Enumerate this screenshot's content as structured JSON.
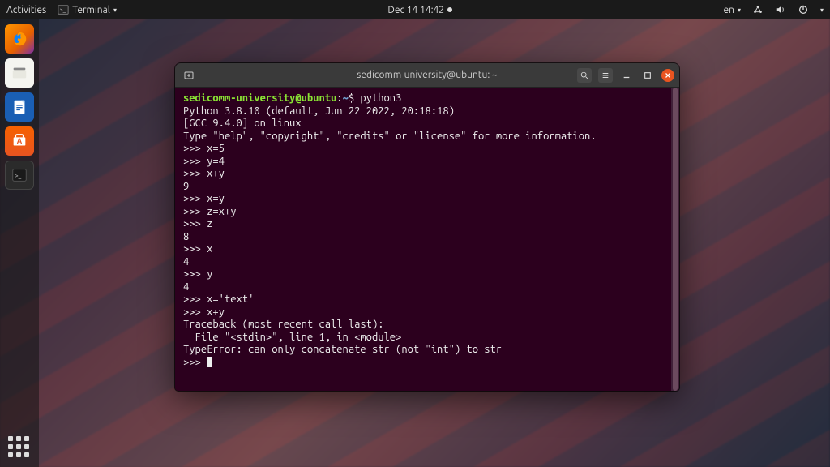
{
  "topbar": {
    "activities": "Activities",
    "app_label": "Terminal",
    "clock": "Dec 14  14:42",
    "lang": "en"
  },
  "dock": {
    "items": [
      "firefox",
      "files",
      "libreoffice-writer",
      "ubuntu-software",
      "terminal"
    ]
  },
  "terminal": {
    "title": "sedicomm-university@ubuntu: ~",
    "prompt_user": "sedicomm-university@ubuntu",
    "prompt_sep": ":",
    "prompt_path": "~",
    "prompt_dollar": "$ ",
    "command": "python3",
    "lines": [
      "Python 3.8.10 (default, Jun 22 2022, 20:18:18) ",
      "[GCC 9.4.0] on linux",
      "Type \"help\", \"copyright\", \"credits\" or \"license\" for more information.",
      ">>> x=5",
      ">>> y=4",
      ">>> x+y",
      "9",
      ">>> x=y",
      ">>> z=x+y",
      ">>> z",
      "8",
      ">>> x",
      "4",
      ">>> y",
      "4",
      ">>> x='text'",
      ">>> x+y",
      "Traceback (most recent call last):",
      "  File \"<stdin>\", line 1, in <module>",
      "TypeError: can only concatenate str (not \"int\") to str",
      ">>> "
    ]
  }
}
